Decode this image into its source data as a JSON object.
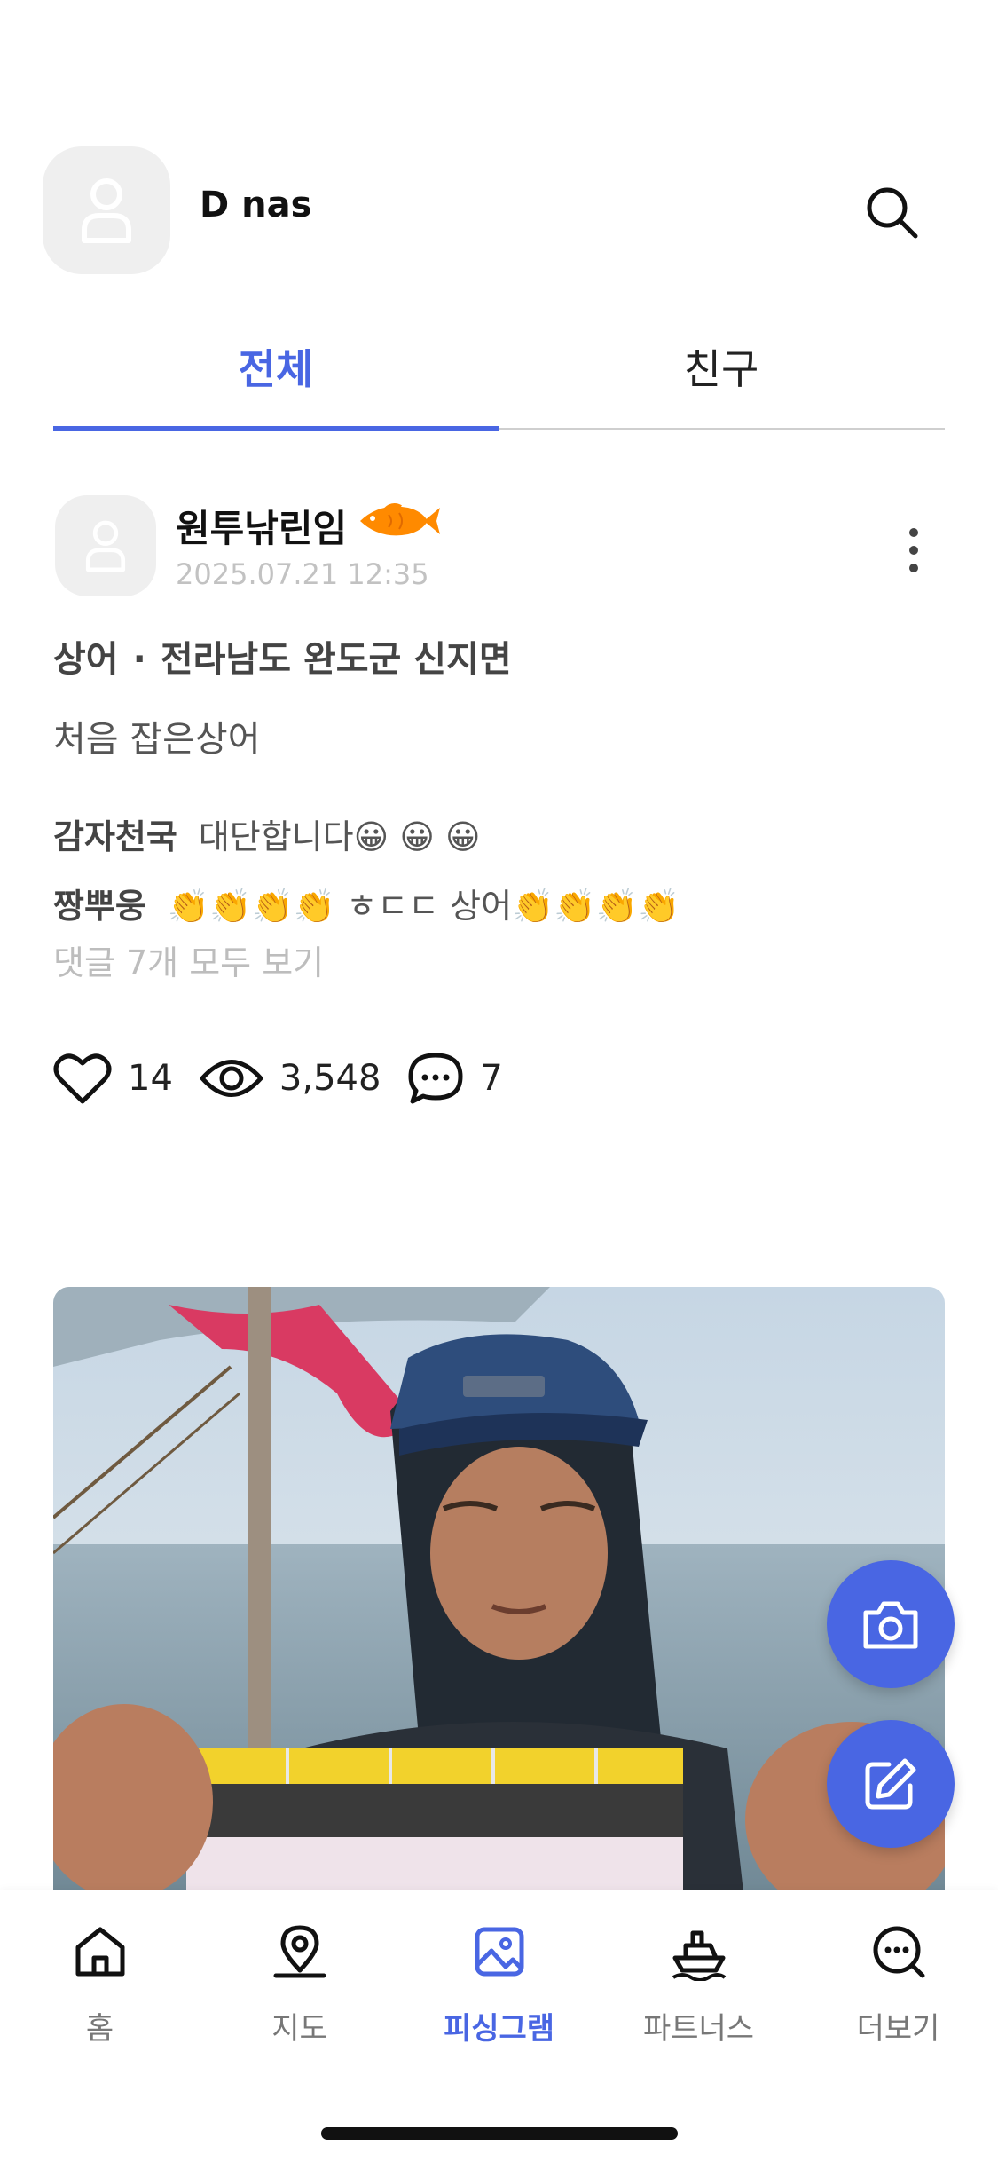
{
  "header": {
    "user_name": "D nas"
  },
  "tabs": [
    {
      "label": "전체",
      "active": true
    },
    {
      "label": "친구",
      "active": false
    }
  ],
  "post": {
    "author": "원투낚린임",
    "timestamp": "2025.07.21 12:35",
    "species": "상어",
    "location": "전라남도 완도군 신지면",
    "body": "처음 잡은상어",
    "comments": [
      {
        "user": "감자천국",
        "text": "대단합니다😀 😀 😀"
      },
      {
        "user": "짱뿌웅",
        "text": "👏👏👏👏 ㅎㄷㄷ 상어👏👏👏👏"
      }
    ],
    "view_all_comments": "댓글 7개 모두 보기",
    "likes": "14",
    "views": "3,548",
    "comment_count": "7"
  },
  "nav": [
    {
      "label": "홈",
      "icon": "home-icon"
    },
    {
      "label": "지도",
      "icon": "map-pin-icon"
    },
    {
      "label": "피싱그램",
      "icon": "image-icon",
      "active": true
    },
    {
      "label": "파트너스",
      "icon": "boat-icon"
    },
    {
      "label": "더보기",
      "icon": "more-chat-icon"
    }
  ],
  "colors": {
    "accent": "#4966e3",
    "muted": "#c2c2c2",
    "avatar_bg": "#efefef",
    "fish": "#ff8a00"
  }
}
